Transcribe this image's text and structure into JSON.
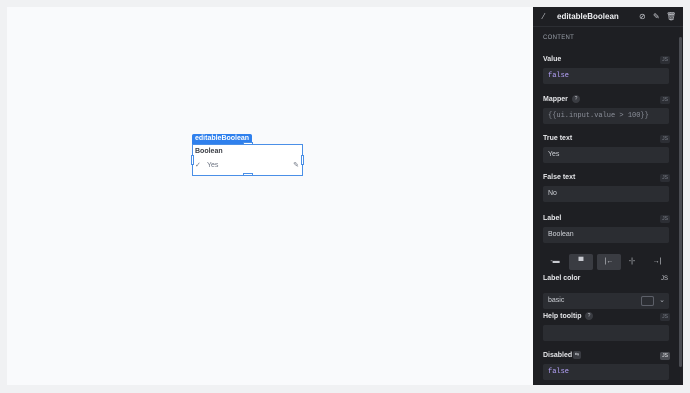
{
  "canvas": {
    "widget": {
      "tag": "editableBoolean",
      "label": "Boolean",
      "check_icon": "check-icon",
      "value": "Yes",
      "edit_icon": "pencil-icon"
    }
  },
  "panel": {
    "header": {
      "widget_icon": "magic-wand-icon",
      "title": "editableBoolean",
      "actions": [
        "unlink-icon",
        "edit-icon",
        "trash-icon"
      ]
    },
    "section": "CONTENT",
    "js": "JS",
    "value": {
      "label": "Value",
      "content": "false"
    },
    "mapper": {
      "label": "Mapper",
      "help": "?",
      "content": "{{ui.input.value > 100}}"
    },
    "true_text": {
      "label": "True text",
      "content": "Yes"
    },
    "false_text": {
      "label": "False text",
      "content": "No"
    },
    "label_field": {
      "label": "Label",
      "content": "Boolean"
    },
    "alignment": {
      "options": [
        "hidden-label-icon",
        "label-top-icon",
        "align-left-icon",
        "align-center-icon",
        "align-right-icon"
      ],
      "selected": [
        "label-top-icon",
        "align-left-icon"
      ]
    },
    "label_color": {
      "label": "Label color",
      "content": "basic",
      "swatch": "#2b2d32"
    },
    "help_tooltip": {
      "label": "Help tooltip",
      "help": "?",
      "content": ""
    },
    "disabled": {
      "label": "Disabled",
      "content": "false"
    }
  },
  "colors": {
    "accent": "#2f80ed",
    "panel_bg": "#1e1f23",
    "field_bg": "#2b2d32",
    "code_text": "#b9a6ff"
  }
}
